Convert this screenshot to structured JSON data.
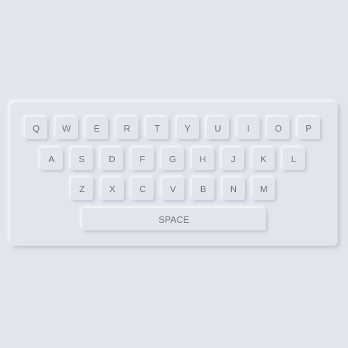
{
  "keyboard": {
    "rows": [
      [
        "Q",
        "W",
        "E",
        "R",
        "T",
        "Y",
        "U",
        "I",
        "O",
        "P"
      ],
      [
        "A",
        "S",
        "D",
        "F",
        "G",
        "H",
        "J",
        "K",
        "L"
      ],
      [
        "Z",
        "X",
        "C",
        "V",
        "B",
        "N",
        "M"
      ]
    ],
    "space_label": "SPACE"
  }
}
